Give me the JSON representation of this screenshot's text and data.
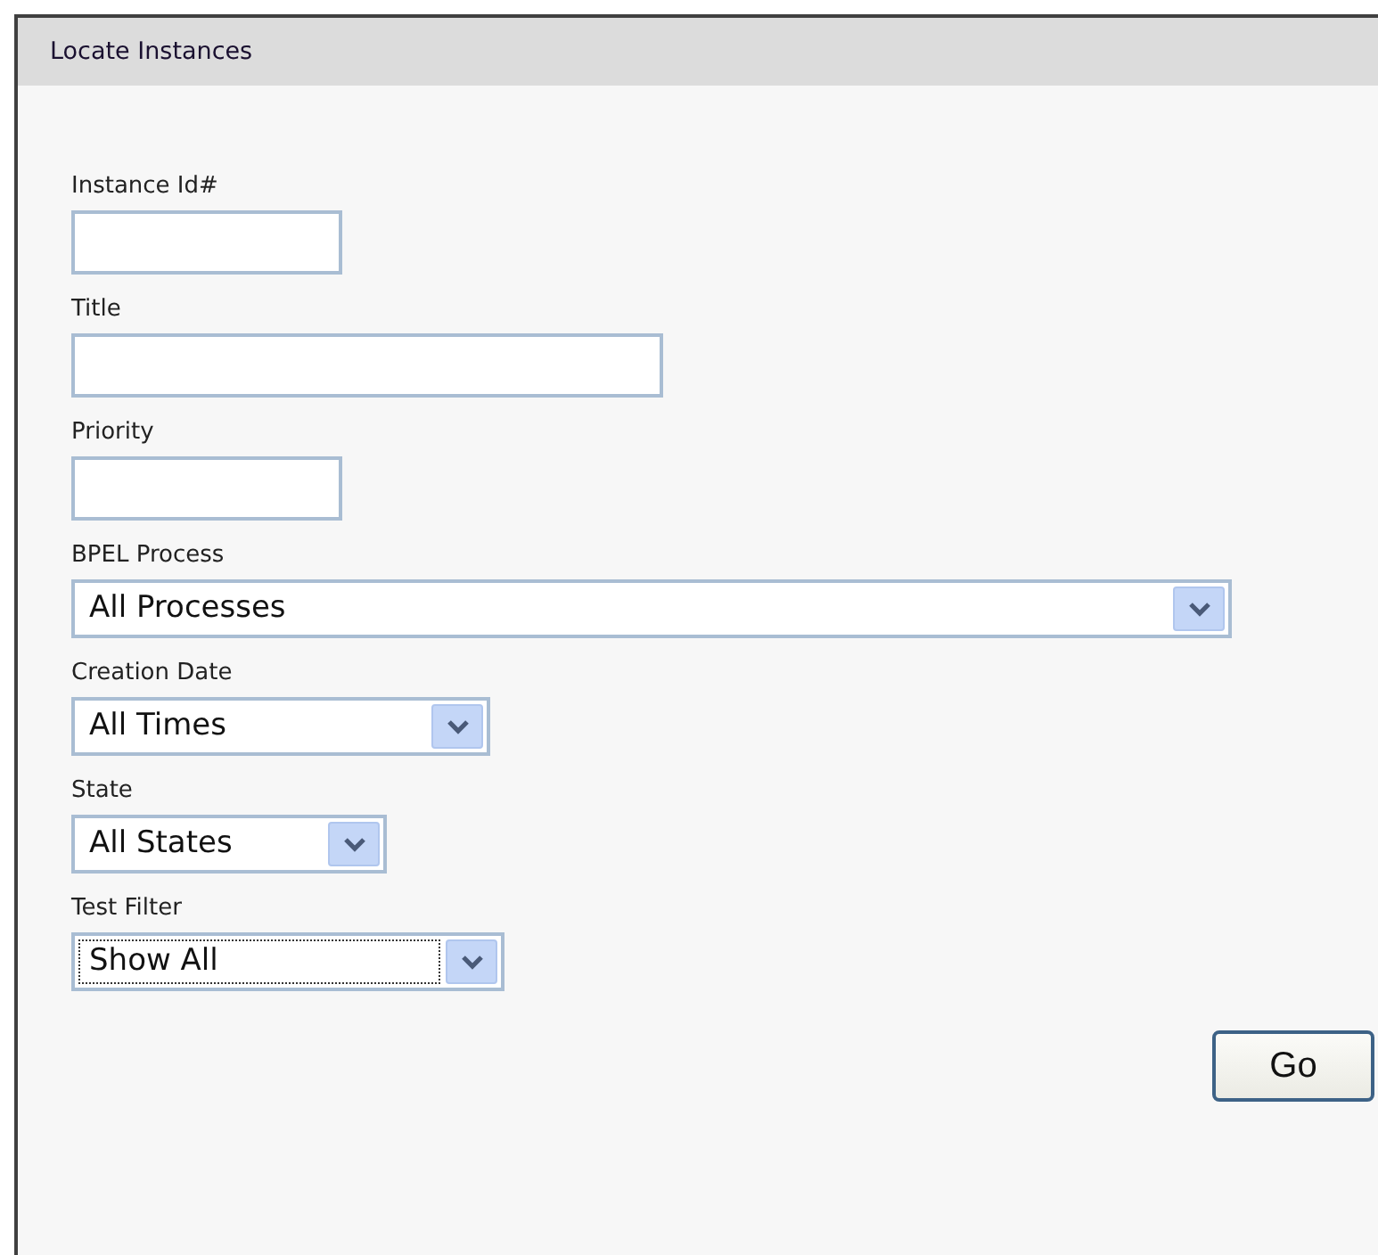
{
  "panel": {
    "title": "Locate Instances"
  },
  "fields": [
    {
      "kind": "text",
      "label": "Instance Id#"
    },
    {
      "kind": "text",
      "label": "Title"
    },
    {
      "kind": "text",
      "label": "Priority"
    },
    {
      "kind": "select",
      "label": "BPEL Process",
      "value": "All Processes",
      "focused": false
    },
    {
      "kind": "select",
      "label": "Creation Date",
      "value": "All Times",
      "focused": false
    },
    {
      "kind": "select",
      "label": "State",
      "value": "All States",
      "focused": false
    },
    {
      "kind": "select",
      "label": "Test Filter",
      "value": "Show All",
      "focused": true
    }
  ],
  "buttons": [
    "Go"
  ]
}
